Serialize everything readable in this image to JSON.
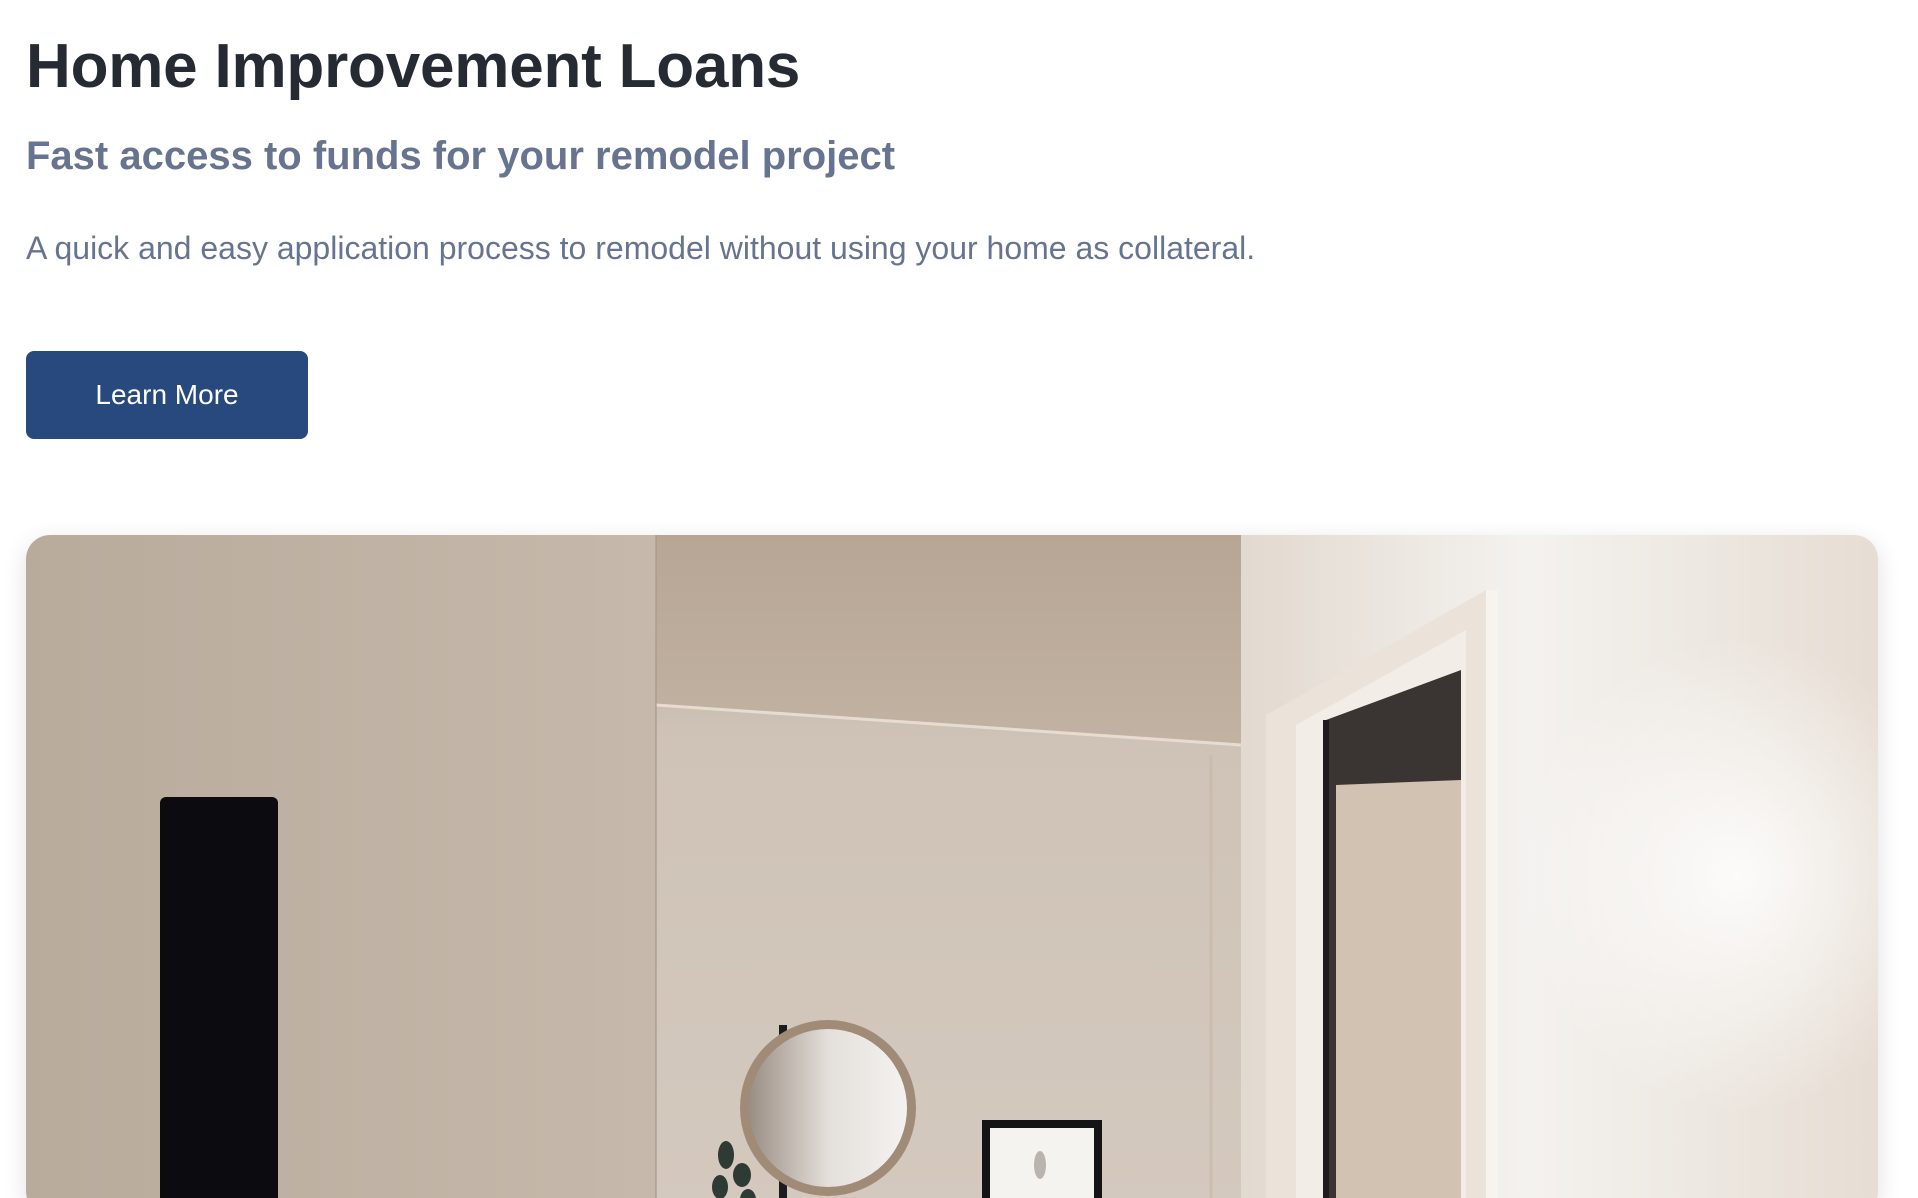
{
  "hero": {
    "title": "Home Improvement Loans",
    "subtitle": "Fast access to funds for your remodel project",
    "description": "A quick and easy application process to remodel without using your home as collateral.",
    "cta_label": "Learn More"
  },
  "colors": {
    "title": "#262a33",
    "muted_text": "#677490",
    "cta_background": "#27497d",
    "cta_text": "#ffffff"
  },
  "image": {
    "subject": "interior-room-photo"
  }
}
